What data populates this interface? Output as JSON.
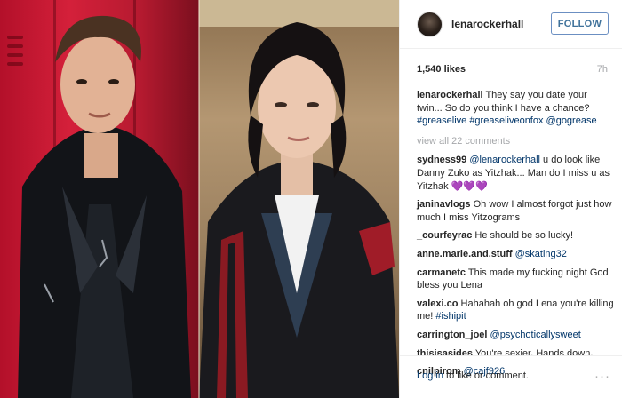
{
  "post": {
    "username": "lenarockerhall",
    "follow_label": "FOLLOW",
    "likes": "1,540 likes",
    "time": "7h"
  },
  "caption": {
    "user": "lenarockerhall",
    "text": "They say you date your twin... So do you think I have a chance? ",
    "tags": "#greaselive #greaseliveonfox @gogrease"
  },
  "view_all": "view all 22 comments",
  "comments": [
    {
      "user": "sydness99",
      "mention": "@lenarockerhall",
      "text": " u do look like Danny Zuko as Yitzhak... Man do I miss u as Yitzhak 💜💜💜"
    },
    {
      "user": "janinavlogs",
      "mention": "",
      "text": " Oh wow I almost forgot just how much I miss Yitzograms"
    },
    {
      "user": "_courfeyrac",
      "mention": "",
      "text": " He should be so lucky!"
    },
    {
      "user": "anne.marie.and.stuff",
      "mention": "@skating32",
      "text": ""
    },
    {
      "user": "carmanetc",
      "mention": "",
      "text": " This made my fucking night God bless you Lena"
    },
    {
      "user": "valexi.co",
      "mention": "",
      "text": " Hahahah oh god Lena you're killing me! ",
      "tag": "#ishipit"
    },
    {
      "user": "carrington_joel",
      "mention": "@psychoticallysweet",
      "text": ""
    },
    {
      "user": "thisisasides",
      "mention": "",
      "text": " You're sexier. Hands down."
    },
    {
      "user": "cnilpirom",
      "mention": "@cajf926",
      "text": ""
    }
  ],
  "footer": {
    "login_link": "Log in",
    "login_text": " to like or comment.",
    "more_glyph": "···"
  },
  "icons": {
    "avatar": "profile-avatar",
    "more": "more-options-icon"
  },
  "colors": {
    "link": "#003569",
    "follow": "#3f729b",
    "muted": "#a5a7aa"
  }
}
